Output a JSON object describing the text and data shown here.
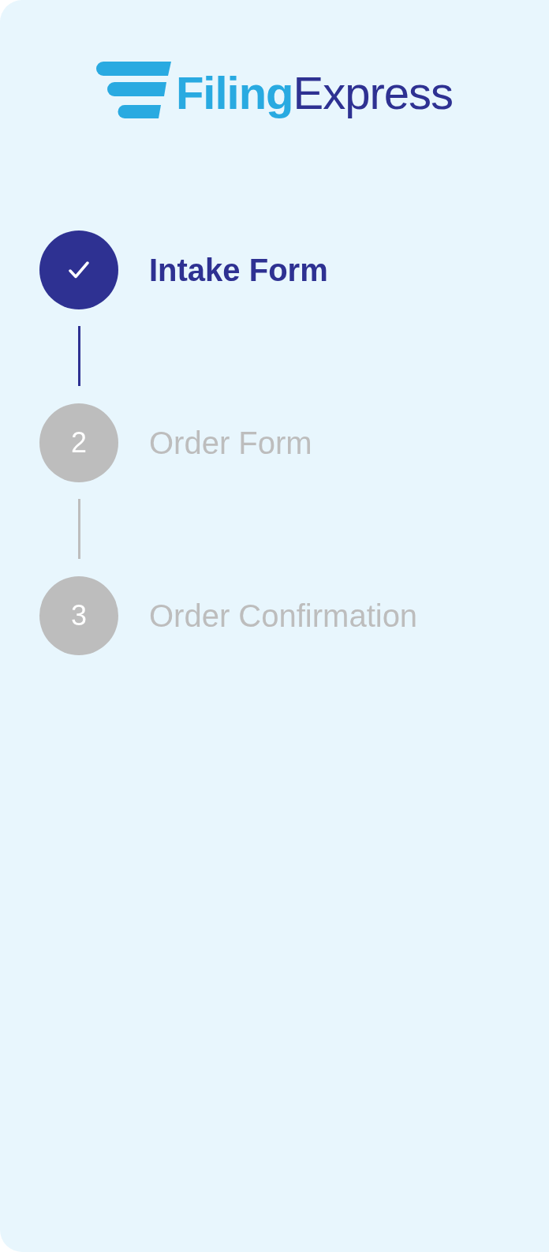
{
  "logo": {
    "brand_first": "Filing",
    "brand_second": "Express"
  },
  "steps": [
    {
      "label": "Intake Form",
      "completed": true
    },
    {
      "label": "Order Form",
      "number": "2",
      "completed": false
    },
    {
      "label": "Order Confirmation",
      "number": "3",
      "completed": false
    }
  ]
}
